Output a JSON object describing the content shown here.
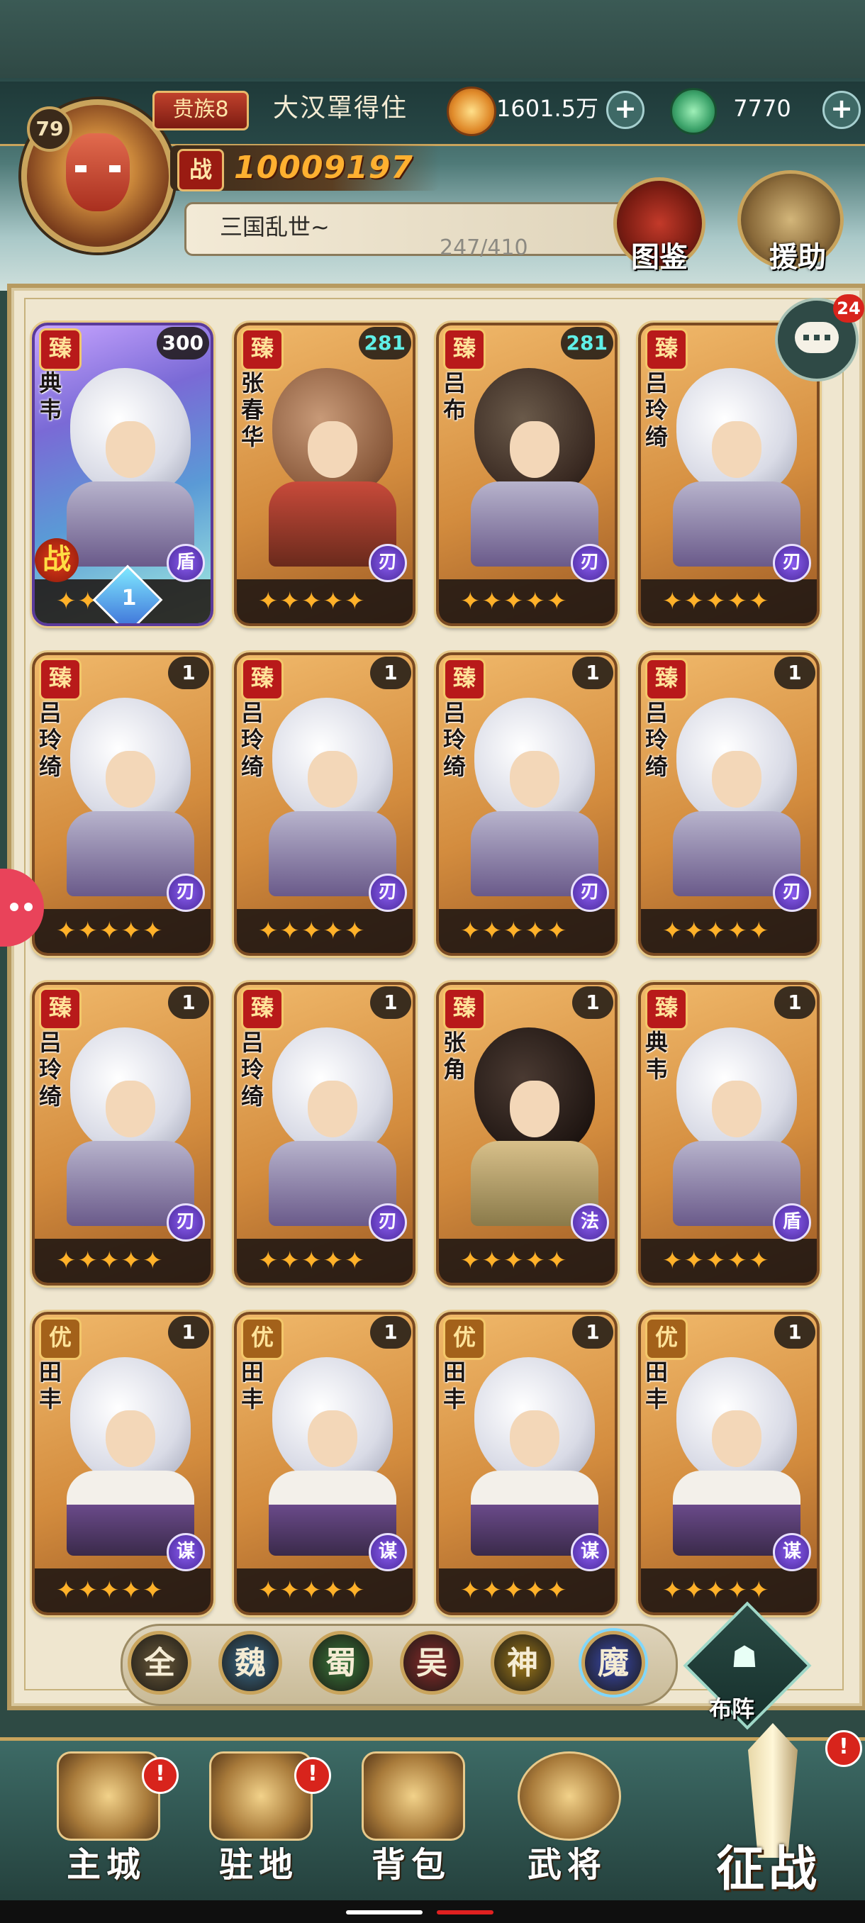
{
  "header": {
    "level": "79",
    "noble_rank": "贵族8",
    "player_name": "大汉罩得住",
    "gold": "1601.5万",
    "jade": "7770",
    "power_label": "战",
    "power": "10009197",
    "guild_name": "三国乱世~",
    "guild_members": "247/410",
    "pedia_label": "图鉴",
    "assist_label": "援助"
  },
  "chat": {
    "unread": "24"
  },
  "cards": [
    {
      "tier": "臻",
      "name": "典韦",
      "level": "300",
      "stars": "✦✦✦✦✦",
      "class": "盾",
      "rank": "1",
      "war": "战"
    },
    {
      "tier": "臻",
      "name": "张春华",
      "level": "281",
      "stars": "✦✦✦✦✦",
      "class": "刃"
    },
    {
      "tier": "臻",
      "name": "吕布",
      "level": "281",
      "stars": "✦✦✦✦✦",
      "class": "刃"
    },
    {
      "tier": "臻",
      "name": "吕玲绮",
      "level": "",
      "stars": "✦✦✦✦✦",
      "class": "刃"
    },
    {
      "tier": "臻",
      "name": "吕玲绮",
      "level": "1",
      "stars": "✦✦✦✦✦",
      "class": "刃"
    },
    {
      "tier": "臻",
      "name": "吕玲绮",
      "level": "1",
      "stars": "✦✦✦✦✦",
      "class": "刃"
    },
    {
      "tier": "臻",
      "name": "吕玲绮",
      "level": "1",
      "stars": "✦✦✦✦✦",
      "class": "刃"
    },
    {
      "tier": "臻",
      "name": "吕玲绮",
      "level": "1",
      "stars": "✦✦✦✦✦",
      "class": "刃"
    },
    {
      "tier": "臻",
      "name": "吕玲绮",
      "level": "1",
      "stars": "✦✦✦✦✦",
      "class": "刃"
    },
    {
      "tier": "臻",
      "name": "吕玲绮",
      "level": "1",
      "stars": "✦✦✦✦✦",
      "class": "刃"
    },
    {
      "tier": "臻",
      "name": "张角",
      "level": "1",
      "stars": "✦✦✦✦✦",
      "class": "法"
    },
    {
      "tier": "臻",
      "name": "典韦",
      "level": "1",
      "stars": "✦✦✦✦✦",
      "class": "盾"
    },
    {
      "tier": "优",
      "name": "田丰",
      "level": "1",
      "stars": "✦✦✦✦✦",
      "class": "谋"
    },
    {
      "tier": "优",
      "name": "田丰",
      "level": "1",
      "stars": "✦✦✦✦✦",
      "class": "谋"
    },
    {
      "tier": "优",
      "name": "田丰",
      "level": "1",
      "stars": "✦✦✦✦✦",
      "class": "谋"
    },
    {
      "tier": "优",
      "name": "田丰",
      "level": "1",
      "stars": "✦✦✦✦✦",
      "class": "谋"
    }
  ],
  "filters": [
    {
      "label": "全",
      "color": "#6b5a3a"
    },
    {
      "label": "魏",
      "color": "#3a6a8a"
    },
    {
      "label": "蜀",
      "color": "#3a7a3a"
    },
    {
      "label": "吴",
      "color": "#8a2a2a"
    },
    {
      "label": "神",
      "color": "#a07a1a"
    },
    {
      "label": "魔",
      "color": "#3a4ab0"
    }
  ],
  "formation_label": "布阵",
  "nav": {
    "city": "主城",
    "camp": "驻地",
    "bag": "背包",
    "generals": "武将",
    "campaign": "征战",
    "alert": "!"
  }
}
